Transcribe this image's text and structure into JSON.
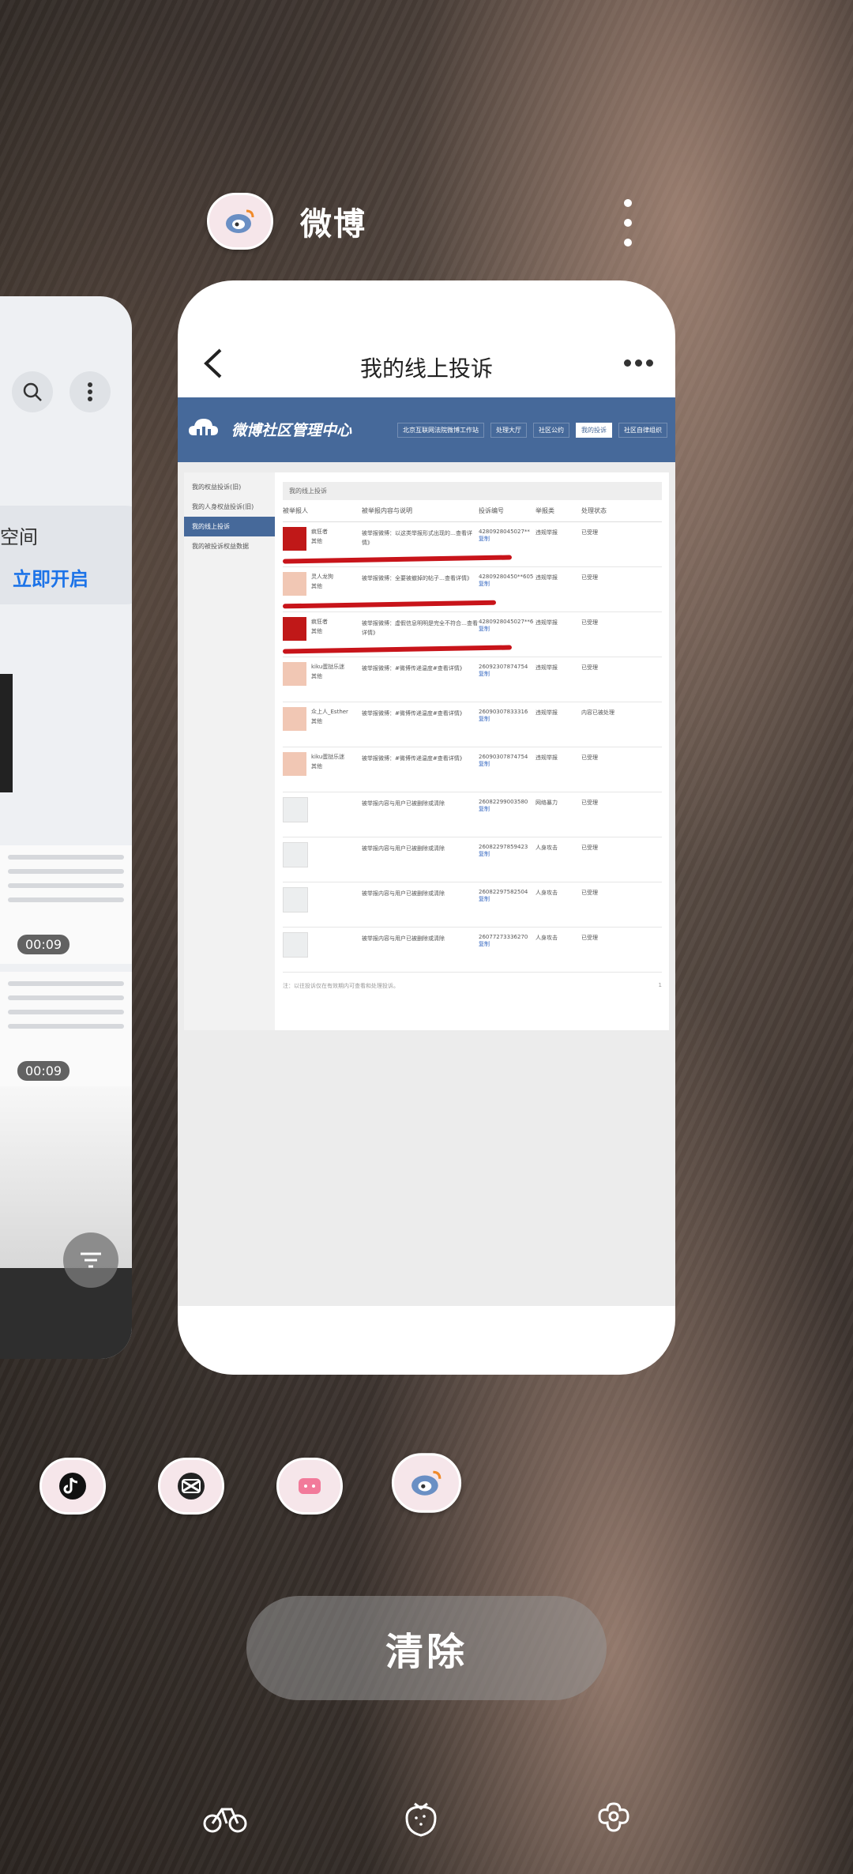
{
  "header": {
    "app_name": "微博"
  },
  "left_card": {
    "banner_text": "空间",
    "banner_action": "立即开启",
    "video_times": [
      "00:09",
      "00:09"
    ]
  },
  "main_card": {
    "title": "我的线上投诉",
    "screenshot": {
      "brand": "微博社区管理中心",
      "tabs": [
        "北京互联网法院微博工作站",
        "处理大厅",
        "社区公约",
        "我的投诉",
        "社区自律组织"
      ],
      "active_tab": "我的投诉",
      "sidebar": [
        "我的权益投诉(旧)",
        "我的人身权益投诉(旧)",
        "我的线上投诉",
        "我的被投诉权益数据"
      ],
      "active_sidebar": "我的线上投诉",
      "breadcrumb": "我的线上投诉",
      "columns": [
        "被举报人",
        "被举报内容与说明",
        "投诉编号",
        "举报类",
        "处理状态"
      ],
      "rows": [
        {
          "name": "疯狂者",
          "tag": "其他",
          "content": "被举报微博：以这类举报形式出现的…查看详情》",
          "id": "4280928045027**",
          "copy": "复制",
          "type": "违规举报",
          "status": "已受理"
        },
        {
          "name": "灵人龙狗",
          "tag": "其他",
          "content": "被举报微博：全要被撤掉的帖子…查看详情》",
          "id": "42809280450**605",
          "copy": "复制",
          "type": "违规举报",
          "status": "已受理"
        },
        {
          "name": "疯狂者",
          "tag": "其他",
          "content": "被举报微博：虚假信息明明是完全不符合…查看详情》",
          "id": "4280928045027**6",
          "copy": "复制",
          "type": "违规举报",
          "status": "已受理"
        },
        {
          "name": "kiku蛋挞乐迷",
          "tag": "其他",
          "content": "被举报微博：#微博传递温度#查看详情》",
          "id": "26092307874754",
          "copy": "复制",
          "type": "违规举报",
          "status": "已受理"
        },
        {
          "name": "众上人_Esther",
          "tag": "其他",
          "content": "被举报微博：#微博传递温度#查看详情》",
          "id": "26090307833316",
          "copy": "复制",
          "type": "违规举报",
          "status": "内容已被处理"
        },
        {
          "name": "kiku蛋挞乐迷",
          "tag": "其他",
          "content": "被举报微博：#微博传递温度#查看详情》",
          "id": "26090307874754",
          "copy": "复制",
          "type": "违规举报",
          "status": "已受理"
        },
        {
          "name": "",
          "tag": "",
          "content": "被举报内容与用户已被删除或清除",
          "id": "26082299003580",
          "copy": "复制",
          "type": "网络暴力",
          "status": "已受理"
        },
        {
          "name": "",
          "tag": "",
          "content": "被举报内容与用户已被删除或清除",
          "id": "26082297859423",
          "copy": "复制",
          "type": "人身攻击",
          "status": "已受理"
        },
        {
          "name": "",
          "tag": "",
          "content": "被举报内容与用户已被删除或清除",
          "id": "26082297582504",
          "copy": "复制",
          "type": "人身攻击",
          "status": "已受理"
        },
        {
          "name": "",
          "tag": "",
          "content": "被举报内容与用户已被删除或清除",
          "id": "26077273336270",
          "copy": "复制",
          "type": "人身攻击",
          "status": "已受理"
        }
      ],
      "footnote": "注：以往投诉仅在有效期内可查看和处理投诉。",
      "page": "1"
    }
  },
  "recent_apps": [
    "tiktok-icon",
    "capcut-icon",
    "video-icon",
    "weibo-icon"
  ],
  "clear_label": "清除",
  "colors": {
    "accent": "#46699a",
    "annotation": "#c8141a"
  }
}
